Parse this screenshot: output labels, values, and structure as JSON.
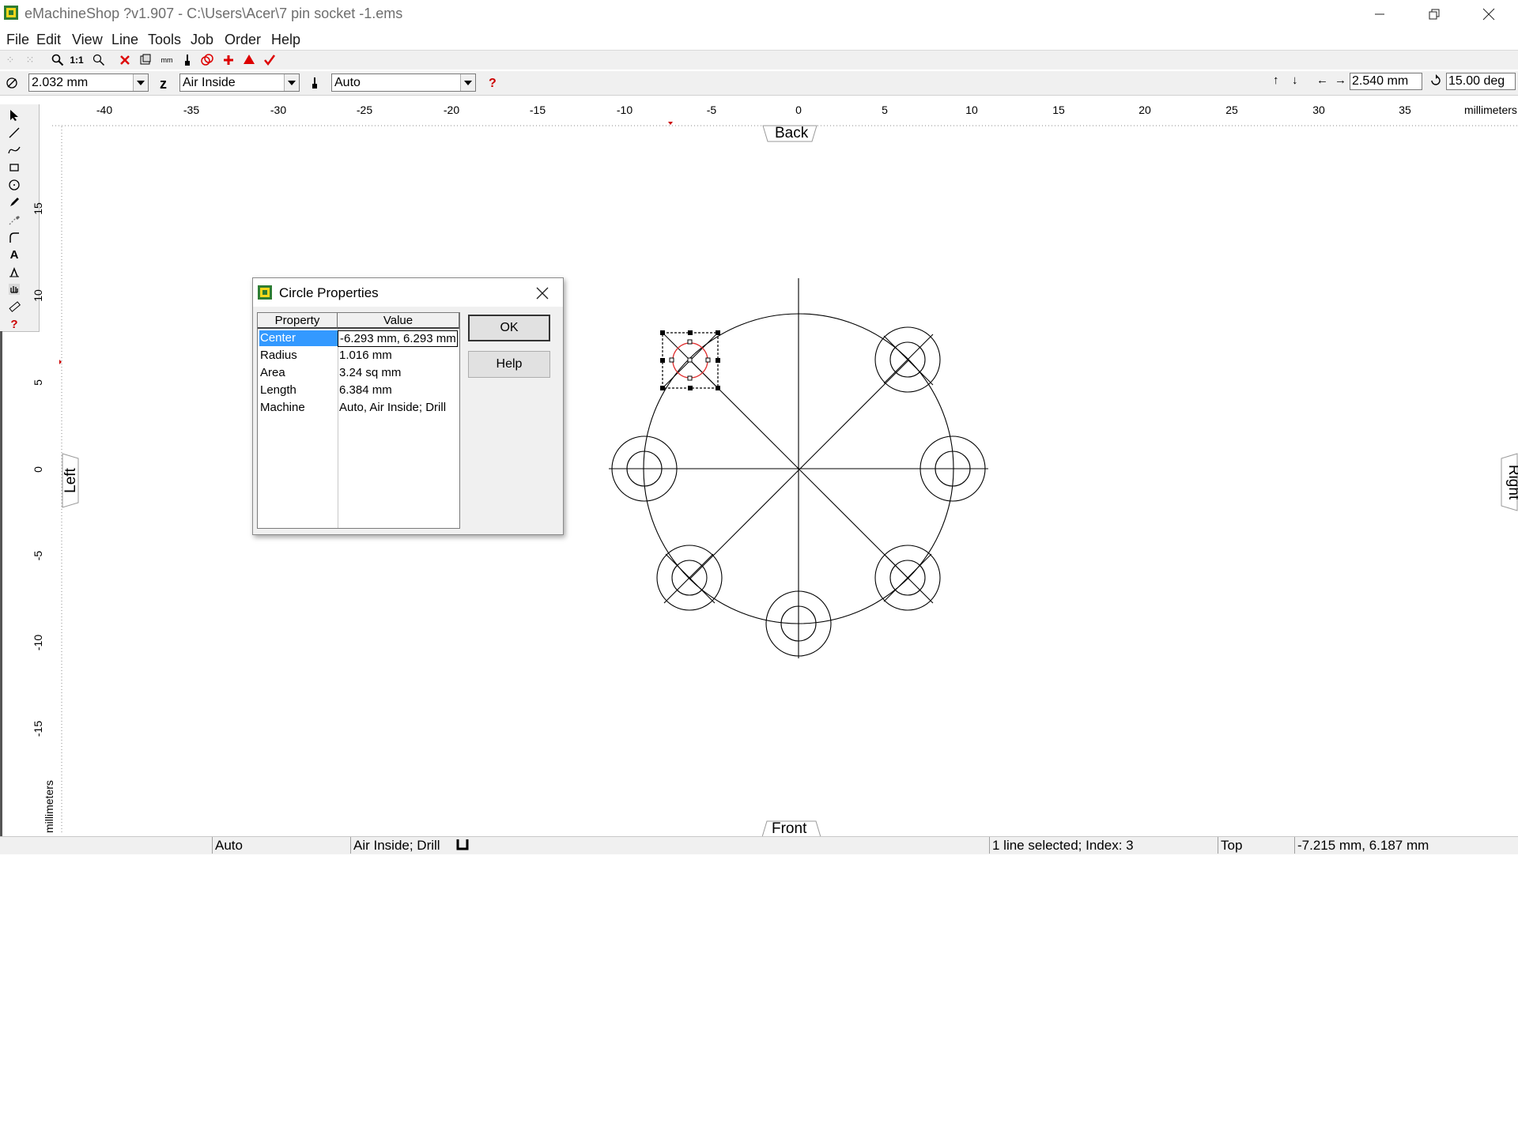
{
  "window": {
    "title": "eMachineShop ?v1.907 - C:\\Users\\Acer\\7 pin socket -1.ems"
  },
  "menu": [
    "File",
    "Edit",
    "View",
    "Line",
    "Tools",
    "Job",
    "Order",
    "Help"
  ],
  "toolbar": {
    "diameter_value": "2.032 mm",
    "depth_label": "z",
    "material_value": "Air Inside",
    "machine_value": "Auto",
    "nudge_value": "2.540 mm",
    "angle_value": "15.00 deg"
  },
  "ruler": {
    "horizontal_unit": "millimeters",
    "horizontal_ticks": [
      "-40",
      "-35",
      "-30",
      "-25",
      "-20",
      "-15",
      "-10",
      "-5",
      "0",
      "5",
      "10",
      "15",
      "20",
      "25",
      "30",
      "35"
    ],
    "vertical_unit": "millimeters",
    "vertical_ticks": [
      "15",
      "10",
      "5",
      "0",
      "-5",
      "-10",
      "-15"
    ]
  },
  "view_tabs": {
    "back": "Back",
    "front": "Front",
    "left": "Left",
    "right": "Right"
  },
  "dialog": {
    "title": "Circle Properties",
    "headers": {
      "property": "Property",
      "value": "Value"
    },
    "rows": [
      {
        "property": "Center",
        "value": "-6.293 mm, 6.293 mm"
      },
      {
        "property": "Radius",
        "value": "1.016 mm"
      },
      {
        "property": "Area",
        "value": "3.24 sq mm"
      },
      {
        "property": "Length",
        "value": "6.384 mm"
      },
      {
        "property": "Machine",
        "value": "Auto, Air Inside; Drill"
      }
    ],
    "ok_label": "OK",
    "help_label": "Help"
  },
  "statusbar": {
    "machine": "Auto",
    "process": "Air Inside; Drill",
    "selection": "1 line selected; Index: 3",
    "view": "Top",
    "coords": "-7.215 mm, 6.187 mm"
  },
  "colors": {
    "selection_highlight": "#3399ff",
    "selected_circle": "#e03030"
  }
}
